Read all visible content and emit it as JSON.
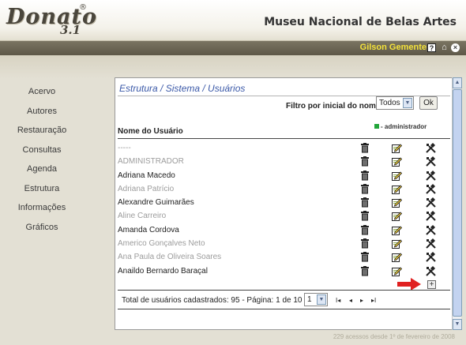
{
  "header": {
    "logo_text": "Donato",
    "logo_version": "3.1",
    "logo_reg": "®",
    "museum": "Museu Nacional de Belas Artes"
  },
  "topbar": {
    "user": "Gilson Gemente",
    "help_glyph": "?",
    "home_glyph": "⌂",
    "close_glyph": "×"
  },
  "sidebar": {
    "items": [
      {
        "label": "Acervo"
      },
      {
        "label": "Autores"
      },
      {
        "label": "Restauração"
      },
      {
        "label": "Consultas"
      },
      {
        "label": "Agenda"
      },
      {
        "label": "Estrutura"
      },
      {
        "label": "Informações"
      },
      {
        "label": "Gráficos"
      }
    ]
  },
  "main": {
    "breadcrumb": "Estrutura / Sistema / Usuários",
    "filter_label": "Filtro por inicial do nome:",
    "filter_value": "Todos",
    "ok_label": "Ok",
    "legend_label": "- administrador",
    "legend_color": "#22a53a",
    "column_header": "Nome do Usuário",
    "users": [
      {
        "name": "-----",
        "active": false
      },
      {
        "name": "ADMINISTRADOR",
        "active": false
      },
      {
        "name": "Adriana Macedo",
        "active": true
      },
      {
        "name": "Adriana Patrício",
        "active": false
      },
      {
        "name": "Alexandre Guimarães",
        "active": true
      },
      {
        "name": "Aline Carreiro",
        "active": false
      },
      {
        "name": "Amanda Cordova",
        "active": true
      },
      {
        "name": "Americo Gonçalves Neto",
        "active": false
      },
      {
        "name": "Ana Paula de Oliveira Soares",
        "active": false
      },
      {
        "name": "Anaildo Bernardo Baraçal",
        "active": true
      }
    ],
    "row_icons": [
      "trash-icon",
      "edit-icon",
      "tools-icon"
    ],
    "add_glyph": "+",
    "arrow_color": "#e02020",
    "total_text": "Total de usuários cadastrados: 95 - Página: 1 de 10",
    "page_value": "1",
    "pager": {
      "first": "I◂",
      "prev": "◂",
      "next": "▸",
      "last": "▸I"
    }
  },
  "footer": {
    "counter": "229 acessos desde 1º de fevereiro de 2008"
  }
}
